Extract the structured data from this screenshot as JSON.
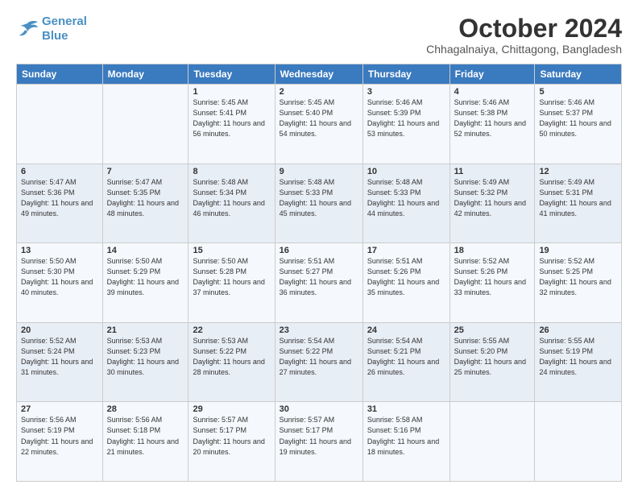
{
  "header": {
    "logo_line1": "General",
    "logo_line2": "Blue",
    "month": "October 2024",
    "location": "Chhagalnaiya, Chittagong, Bangladesh"
  },
  "days_of_week": [
    "Sunday",
    "Monday",
    "Tuesday",
    "Wednesday",
    "Thursday",
    "Friday",
    "Saturday"
  ],
  "weeks": [
    [
      {
        "day": "",
        "info": ""
      },
      {
        "day": "",
        "info": ""
      },
      {
        "day": "1",
        "info": "Sunrise: 5:45 AM\nSunset: 5:41 PM\nDaylight: 11 hours\nand 56 minutes."
      },
      {
        "day": "2",
        "info": "Sunrise: 5:45 AM\nSunset: 5:40 PM\nDaylight: 11 hours\nand 54 minutes."
      },
      {
        "day": "3",
        "info": "Sunrise: 5:46 AM\nSunset: 5:39 PM\nDaylight: 11 hours\nand 53 minutes."
      },
      {
        "day": "4",
        "info": "Sunrise: 5:46 AM\nSunset: 5:38 PM\nDaylight: 11 hours\nand 52 minutes."
      },
      {
        "day": "5",
        "info": "Sunrise: 5:46 AM\nSunset: 5:37 PM\nDaylight: 11 hours\nand 50 minutes."
      }
    ],
    [
      {
        "day": "6",
        "info": "Sunrise: 5:47 AM\nSunset: 5:36 PM\nDaylight: 11 hours\nand 49 minutes."
      },
      {
        "day": "7",
        "info": "Sunrise: 5:47 AM\nSunset: 5:35 PM\nDaylight: 11 hours\nand 48 minutes."
      },
      {
        "day": "8",
        "info": "Sunrise: 5:48 AM\nSunset: 5:34 PM\nDaylight: 11 hours\nand 46 minutes."
      },
      {
        "day": "9",
        "info": "Sunrise: 5:48 AM\nSunset: 5:33 PM\nDaylight: 11 hours\nand 45 minutes."
      },
      {
        "day": "10",
        "info": "Sunrise: 5:48 AM\nSunset: 5:33 PM\nDaylight: 11 hours\nand 44 minutes."
      },
      {
        "day": "11",
        "info": "Sunrise: 5:49 AM\nSunset: 5:32 PM\nDaylight: 11 hours\nand 42 minutes."
      },
      {
        "day": "12",
        "info": "Sunrise: 5:49 AM\nSunset: 5:31 PM\nDaylight: 11 hours\nand 41 minutes."
      }
    ],
    [
      {
        "day": "13",
        "info": "Sunrise: 5:50 AM\nSunset: 5:30 PM\nDaylight: 11 hours\nand 40 minutes."
      },
      {
        "day": "14",
        "info": "Sunrise: 5:50 AM\nSunset: 5:29 PM\nDaylight: 11 hours\nand 39 minutes."
      },
      {
        "day": "15",
        "info": "Sunrise: 5:50 AM\nSunset: 5:28 PM\nDaylight: 11 hours\nand 37 minutes."
      },
      {
        "day": "16",
        "info": "Sunrise: 5:51 AM\nSunset: 5:27 PM\nDaylight: 11 hours\nand 36 minutes."
      },
      {
        "day": "17",
        "info": "Sunrise: 5:51 AM\nSunset: 5:26 PM\nDaylight: 11 hours\nand 35 minutes."
      },
      {
        "day": "18",
        "info": "Sunrise: 5:52 AM\nSunset: 5:26 PM\nDaylight: 11 hours\nand 33 minutes."
      },
      {
        "day": "19",
        "info": "Sunrise: 5:52 AM\nSunset: 5:25 PM\nDaylight: 11 hours\nand 32 minutes."
      }
    ],
    [
      {
        "day": "20",
        "info": "Sunrise: 5:52 AM\nSunset: 5:24 PM\nDaylight: 11 hours\nand 31 minutes."
      },
      {
        "day": "21",
        "info": "Sunrise: 5:53 AM\nSunset: 5:23 PM\nDaylight: 11 hours\nand 30 minutes."
      },
      {
        "day": "22",
        "info": "Sunrise: 5:53 AM\nSunset: 5:22 PM\nDaylight: 11 hours\nand 28 minutes."
      },
      {
        "day": "23",
        "info": "Sunrise: 5:54 AM\nSunset: 5:22 PM\nDaylight: 11 hours\nand 27 minutes."
      },
      {
        "day": "24",
        "info": "Sunrise: 5:54 AM\nSunset: 5:21 PM\nDaylight: 11 hours\nand 26 minutes."
      },
      {
        "day": "25",
        "info": "Sunrise: 5:55 AM\nSunset: 5:20 PM\nDaylight: 11 hours\nand 25 minutes."
      },
      {
        "day": "26",
        "info": "Sunrise: 5:55 AM\nSunset: 5:19 PM\nDaylight: 11 hours\nand 24 minutes."
      }
    ],
    [
      {
        "day": "27",
        "info": "Sunrise: 5:56 AM\nSunset: 5:19 PM\nDaylight: 11 hours\nand 22 minutes."
      },
      {
        "day": "28",
        "info": "Sunrise: 5:56 AM\nSunset: 5:18 PM\nDaylight: 11 hours\nand 21 minutes."
      },
      {
        "day": "29",
        "info": "Sunrise: 5:57 AM\nSunset: 5:17 PM\nDaylight: 11 hours\nand 20 minutes."
      },
      {
        "day": "30",
        "info": "Sunrise: 5:57 AM\nSunset: 5:17 PM\nDaylight: 11 hours\nand 19 minutes."
      },
      {
        "day": "31",
        "info": "Sunrise: 5:58 AM\nSunset: 5:16 PM\nDaylight: 11 hours\nand 18 minutes."
      },
      {
        "day": "",
        "info": ""
      },
      {
        "day": "",
        "info": ""
      }
    ]
  ]
}
